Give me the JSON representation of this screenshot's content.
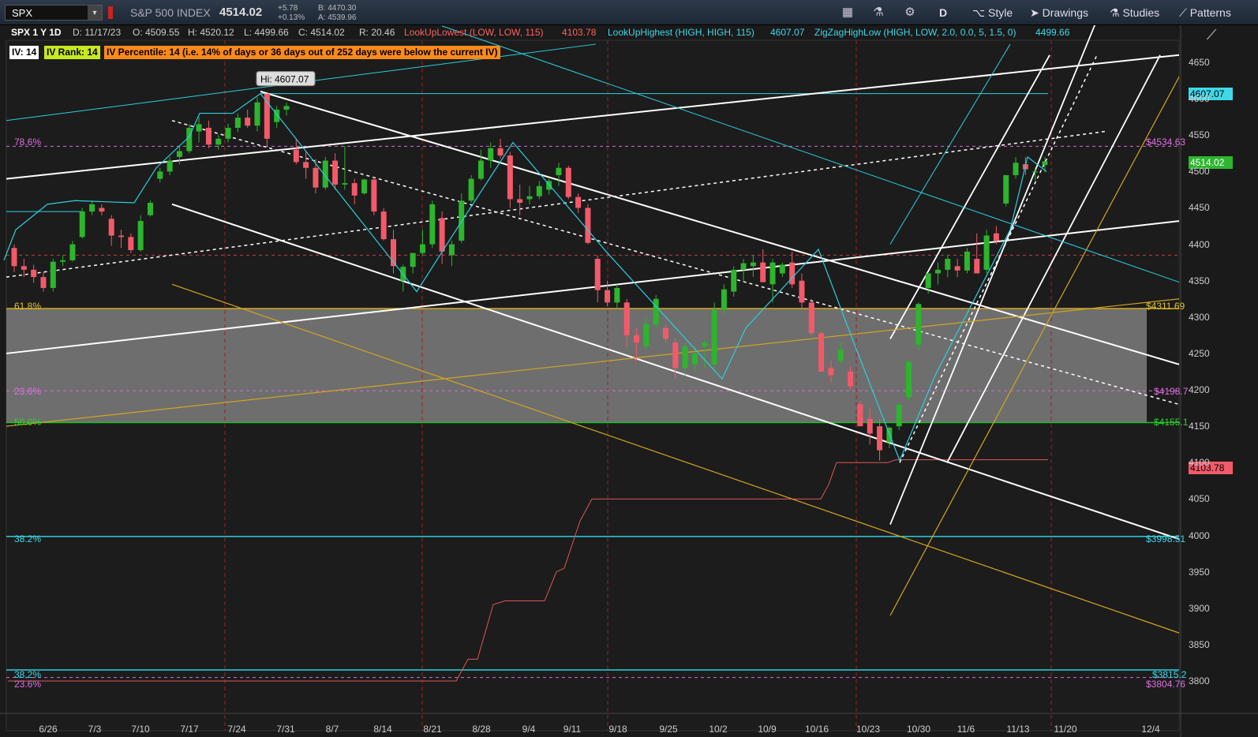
{
  "toolbar": {
    "symbol": "SPX",
    "index_name": "S&P 500 INDEX",
    "last": "4514.02",
    "change": "+5.78",
    "change_pct": "+0.13%",
    "bid": "B: 4470.30",
    "ask": "A: 4539.96",
    "timeframe": "D",
    "style_label": "Style",
    "drawings_label": "Drawings",
    "studies_label": "Studies",
    "patterns_label": "Patterns"
  },
  "header": {
    "title": "SPX 1 Y 1D",
    "date": "D: 11/17/23",
    "open": "O: 4509.55",
    "high": "H: 4520.12",
    "low": "L: 4499.66",
    "close": "C: 4514.02",
    "range": "R: 20.46",
    "study1": "LookUpLowest (LOW, LOW, 115)",
    "study1_val": "4103.78",
    "study2": "LookUpHighest (HIGH, HIGH, 115)",
    "study2_val": "4607.07",
    "study3": "ZigZagHighLow (HIGH, LOW, 2.0, 0.0, 5, 1.5, 0)",
    "study3_val": "4499.66",
    "iv": "IV: 14",
    "iv_rank": "IV Rank: 14",
    "iv_pct": "IV Percentile: 14 (i.e. 14% of days or 36 days out of 252 days were below the current IV)"
  },
  "levels": {
    "fib786": "78.6%",
    "fib618": "61.8%",
    "fib236": "23.6%",
    "fib500": "50.0%",
    "fib382": "38.2%",
    "fib382b": "38.2%",
    "fib236b": "23.6%",
    "p4534": "$4534.63",
    "p4311": "$4311.69",
    "p4198": "$4198.7",
    "p4155": "$4155.1",
    "p3998": "$3998.51",
    "p3815": "$3815.2",
    "p3804": "$3804.76",
    "hi_label": "Hi: 4607.07"
  },
  "price_tags": {
    "high": "4607.07",
    "last": "4514.02",
    "low": "4103.78"
  },
  "colors": {
    "up": "#2db52d",
    "down": "#f25a6a",
    "cyan": "#2ad0e0",
    "gold": "#d4a520",
    "magenta": "#d070d0",
    "green_line": "#22c022"
  },
  "chart_data": {
    "type": "candlestick",
    "ylim": [
      3770,
      4670
    ],
    "y_ticks": [
      3800,
      3850,
      3900,
      3950,
      4000,
      4050,
      4100,
      4150,
      4200,
      4250,
      4300,
      4350,
      4400,
      4450,
      4500,
      4550,
      4600,
      4650
    ],
    "x_labels": [
      "6/26",
      "7/3",
      "7/10",
      "7/17",
      "7/24",
      "7/31",
      "8/7",
      "8/14",
      "8/21",
      "8/28",
      "9/4",
      "9/11",
      "9/18",
      "9/25",
      "10/2",
      "10/9",
      "10/16",
      "10/23",
      "10/30",
      "11/6",
      "11/13",
      "11/20",
      "12/4"
    ],
    "candles": [
      {
        "o": 4395,
        "h": 4400,
        "l": 4362,
        "c": 4370
      },
      {
        "o": 4370,
        "h": 4380,
        "l": 4355,
        "c": 4365
      },
      {
        "o": 4365,
        "h": 4372,
        "l": 4347,
        "c": 4355
      },
      {
        "o": 4355,
        "h": 4362,
        "l": 4335,
        "c": 4340
      },
      {
        "o": 4340,
        "h": 4380,
        "l": 4335,
        "c": 4376
      },
      {
        "o": 4376,
        "h": 4385,
        "l": 4370,
        "c": 4378
      },
      {
        "o": 4378,
        "h": 4405,
        "l": 4376,
        "c": 4400
      },
      {
        "o": 4410,
        "h": 4450,
        "l": 4408,
        "c": 4445
      },
      {
        "o": 4445,
        "h": 4460,
        "l": 4440,
        "c": 4455
      },
      {
        "o": 4450,
        "h": 4455,
        "l": 4440,
        "c": 4445
      },
      {
        "o": 4435,
        "h": 4440,
        "l": 4398,
        "c": 4412
      },
      {
        "o": 4412,
        "h": 4420,
        "l": 4395,
        "c": 4410
      },
      {
        "o": 4410,
        "h": 4415,
        "l": 4388,
        "c": 4392
      },
      {
        "o": 4392,
        "h": 4440,
        "l": 4390,
        "c": 4432
      },
      {
        "o": 4440,
        "h": 4460,
        "l": 4438,
        "c": 4457
      },
      {
        "o": 4490,
        "h": 4505,
        "l": 4485,
        "c": 4500
      },
      {
        "o": 4500,
        "h": 4520,
        "l": 4495,
        "c": 4515
      },
      {
        "o": 4520,
        "h": 4535,
        "l": 4510,
        "c": 4528
      },
      {
        "o": 4528,
        "h": 4565,
        "l": 4525,
        "c": 4560
      },
      {
        "o": 4555,
        "h": 4575,
        "l": 4540,
        "c": 4565
      },
      {
        "o": 4560,
        "h": 4570,
        "l": 4532,
        "c": 4537
      },
      {
        "o": 4537,
        "h": 4550,
        "l": 4530,
        "c": 4545
      },
      {
        "o": 4545,
        "h": 4566,
        "l": 4540,
        "c": 4560
      },
      {
        "o": 4560,
        "h": 4580,
        "l": 4554,
        "c": 4574
      },
      {
        "o": 4574,
        "h": 4585,
        "l": 4560,
        "c": 4563
      },
      {
        "o": 4563,
        "h": 4602,
        "l": 4555,
        "c": 4595
      },
      {
        "o": 4607,
        "h": 4607,
        "l": 4535,
        "c": 4545
      },
      {
        "o": 4568,
        "h": 4590,
        "l": 4560,
        "c": 4585
      },
      {
        "o": 4585,
        "h": 4595,
        "l": 4577,
        "c": 4590
      },
      {
        "o": 4530,
        "h": 4545,
        "l": 4510,
        "c": 4513
      },
      {
        "o": 4513,
        "h": 4528,
        "l": 4490,
        "c": 4505
      },
      {
        "o": 4505,
        "h": 4517,
        "l": 4470,
        "c": 4478
      },
      {
        "o": 4478,
        "h": 4520,
        "l": 4475,
        "c": 4515
      },
      {
        "o": 4515,
        "h": 4525,
        "l": 4475,
        "c": 4482
      },
      {
        "o": 4482,
        "h": 4535,
        "l": 4475,
        "c": 4484
      },
      {
        "o": 4484,
        "h": 4490,
        "l": 4455,
        "c": 4467
      },
      {
        "o": 4470,
        "h": 4490,
        "l": 4468,
        "c": 4489
      },
      {
        "o": 4489,
        "h": 4492,
        "l": 4440,
        "c": 4445
      },
      {
        "o": 4445,
        "h": 4450,
        "l": 4405,
        "c": 4407
      },
      {
        "o": 4407,
        "h": 4420,
        "l": 4360,
        "c": 4370
      },
      {
        "o": 4350,
        "h": 4372,
        "l": 4335,
        "c": 4369
      },
      {
        "o": 4369,
        "h": 4385,
        "l": 4360,
        "c": 4388
      },
      {
        "o": 4388,
        "h": 4420,
        "l": 4385,
        "c": 4400
      },
      {
        "o": 4400,
        "h": 4460,
        "l": 4395,
        "c": 4455
      },
      {
        "o": 4436,
        "h": 4445,
        "l": 4373,
        "c": 4390
      },
      {
        "o": 4385,
        "h": 4405,
        "l": 4370,
        "c": 4400
      },
      {
        "o": 4405,
        "h": 4470,
        "l": 4402,
        "c": 4460
      },
      {
        "o": 4460,
        "h": 4495,
        "l": 4457,
        "c": 4490
      },
      {
        "o": 4490,
        "h": 4530,
        "l": 4488,
        "c": 4515
      },
      {
        "o": 4515,
        "h": 4540,
        "l": 4505,
        "c": 4532
      },
      {
        "o": 4532,
        "h": 4545,
        "l": 4518,
        "c": 4522
      },
      {
        "o": 4522,
        "h": 4527,
        "l": 4450,
        "c": 4462
      },
      {
        "o": 4462,
        "h": 4482,
        "l": 4440,
        "c": 4457
      },
      {
        "o": 4462,
        "h": 4480,
        "l": 4455,
        "c": 4466
      },
      {
        "o": 4466,
        "h": 4487,
        "l": 4462,
        "c": 4480
      },
      {
        "o": 4475,
        "h": 4490,
        "l": 4468,
        "c": 4487
      },
      {
        "o": 4495,
        "h": 4512,
        "l": 4480,
        "c": 4505
      },
      {
        "o": 4505,
        "h": 4508,
        "l": 4462,
        "c": 4465
      },
      {
        "o": 4465,
        "h": 4470,
        "l": 4443,
        "c": 4450
      },
      {
        "o": 4450,
        "h": 4455,
        "l": 4400,
        "c": 4402
      },
      {
        "o": 4380,
        "h": 4385,
        "l": 4320,
        "c": 4337
      },
      {
        "o": 4337,
        "h": 4350,
        "l": 4315,
        "c": 4320
      },
      {
        "o": 4320,
        "h": 4345,
        "l": 4312,
        "c": 4340
      },
      {
        "o": 4320,
        "h": 4325,
        "l": 4260,
        "c": 4275
      },
      {
        "o": 4275,
        "h": 4285,
        "l": 4240,
        "c": 4265
      },
      {
        "o": 4260,
        "h": 4300,
        "l": 4255,
        "c": 4290
      },
      {
        "o": 4290,
        "h": 4330,
        "l": 4285,
        "c": 4325
      },
      {
        "o": 4285,
        "h": 4290,
        "l": 4265,
        "c": 4270
      },
      {
        "o": 4265,
        "h": 4270,
        "l": 4215,
        "c": 4230
      },
      {
        "o": 4230,
        "h": 4265,
        "l": 4220,
        "c": 4260
      },
      {
        "o": 4235,
        "h": 4260,
        "l": 4225,
        "c": 4250
      },
      {
        "o": 4260,
        "h": 4270,
        "l": 4230,
        "c": 4265
      },
      {
        "o": 4235,
        "h": 4320,
        "l": 4230,
        "c": 4310
      },
      {
        "o": 4310,
        "h": 4345,
        "l": 4305,
        "c": 4338
      },
      {
        "o": 4335,
        "h": 4370,
        "l": 4328,
        "c": 4365
      },
      {
        "o": 4365,
        "h": 4380,
        "l": 4350,
        "c": 4374
      },
      {
        "o": 4370,
        "h": 4385,
        "l": 4355,
        "c": 4375
      },
      {
        "o": 4375,
        "h": 4393,
        "l": 4360,
        "c": 4348
      },
      {
        "o": 4345,
        "h": 4380,
        "l": 4320,
        "c": 4375
      },
      {
        "o": 4360,
        "h": 4375,
        "l": 4355,
        "c": 4372
      },
      {
        "o": 4375,
        "h": 4390,
        "l": 4340,
        "c": 4345
      },
      {
        "o": 4350,
        "h": 4360,
        "l": 4310,
        "c": 4320
      },
      {
        "o": 4320,
        "h": 4325,
        "l": 4275,
        "c": 4278
      },
      {
        "o": 4278,
        "h": 4280,
        "l": 4230,
        "c": 4225
      },
      {
        "o": 4230,
        "h": 4240,
        "l": 4210,
        "c": 4220
      },
      {
        "o": 4240,
        "h": 4265,
        "l": 4235,
        "c": 4255
      },
      {
        "o": 4225,
        "h": 4232,
        "l": 4200,
        "c": 4205
      },
      {
        "o": 4180,
        "h": 4185,
        "l": 4150,
        "c": 4150
      },
      {
        "o": 4160,
        "h": 4175,
        "l": 4125,
        "c": 4140
      },
      {
        "o": 4150,
        "h": 4160,
        "l": 4103,
        "c": 4117
      },
      {
        "o": 4128,
        "h": 4150,
        "l": 4120,
        "c": 4148
      },
      {
        "o": 4150,
        "h": 4180,
        "l": 4145,
        "c": 4180
      },
      {
        "o": 4190,
        "h": 4240,
        "l": 4185,
        "c": 4238
      },
      {
        "o": 4262,
        "h": 4320,
        "l": 4255,
        "c": 4318
      },
      {
        "o": 4340,
        "h": 4360,
        "l": 4332,
        "c": 4360
      },
      {
        "o": 4360,
        "h": 4375,
        "l": 4345,
        "c": 4365
      },
      {
        "o": 4365,
        "h": 4385,
        "l": 4355,
        "c": 4380
      },
      {
        "o": 4370,
        "h": 4380,
        "l": 4355,
        "c": 4364
      },
      {
        "o": 4364,
        "h": 4395,
        "l": 4360,
        "c": 4390
      },
      {
        "o": 4380,
        "h": 4415,
        "l": 4375,
        "c": 4360
      },
      {
        "o": 4365,
        "h": 4420,
        "l": 4360,
        "c": 4412
      },
      {
        "o": 4415,
        "h": 4425,
        "l": 4400,
        "c": 4405
      },
      {
        "o": 4456,
        "h": 4495,
        "l": 4452,
        "c": 4495
      },
      {
        "o": 4495,
        "h": 4520,
        "l": 4490,
        "c": 4512
      },
      {
        "o": 4510,
        "h": 4520,
        "l": 4495,
        "c": 4503
      },
      {
        "o": 4500,
        "h": 4505,
        "l": 4488,
        "c": 4500
      },
      {
        "o": 4509,
        "h": 4520,
        "l": 4499,
        "c": 4514
      }
    ]
  }
}
